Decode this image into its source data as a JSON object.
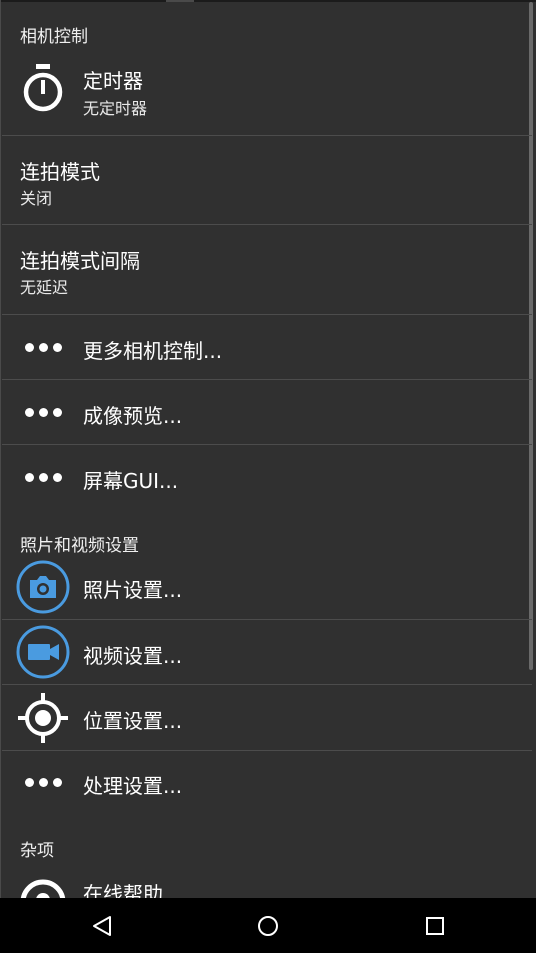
{
  "sections": {
    "camera_controls": "相机控制",
    "photo_video": "照片和视频设置",
    "misc": "杂项"
  },
  "items": {
    "timer": {
      "title": "定时器",
      "summary": "无定时器",
      "icon": "timer-icon"
    },
    "burst_mode": {
      "title": "连拍模式",
      "summary": "关闭"
    },
    "burst_interval": {
      "title": "连拍模式间隔",
      "summary": "无延迟"
    },
    "more_camera_controls": {
      "title": "更多相机控制...",
      "icon": "more-dots-icon"
    },
    "preview": {
      "title": "成像预览...",
      "icon": "more-dots-icon"
    },
    "screen_gui": {
      "title": "屏幕GUI...",
      "icon": "more-dots-icon"
    },
    "photo_settings": {
      "title": "照片设置...",
      "icon": "camera-icon"
    },
    "video_settings": {
      "title": "视频设置...",
      "icon": "video-camera-icon"
    },
    "location_settings": {
      "title": "位置设置...",
      "icon": "location-target-icon"
    },
    "processing_settings": {
      "title": "处理设置...",
      "icon": "more-dots-icon"
    },
    "online_help": {
      "title": "在线帮助",
      "icon": "help-icon"
    }
  },
  "navigation": {
    "back": "back-triangle-icon",
    "home": "home-circle-icon",
    "recents": "recents-square-icon"
  },
  "colors": {
    "background": "#303030",
    "accent": "#4a9be0",
    "divider": "#4c4c4c"
  }
}
